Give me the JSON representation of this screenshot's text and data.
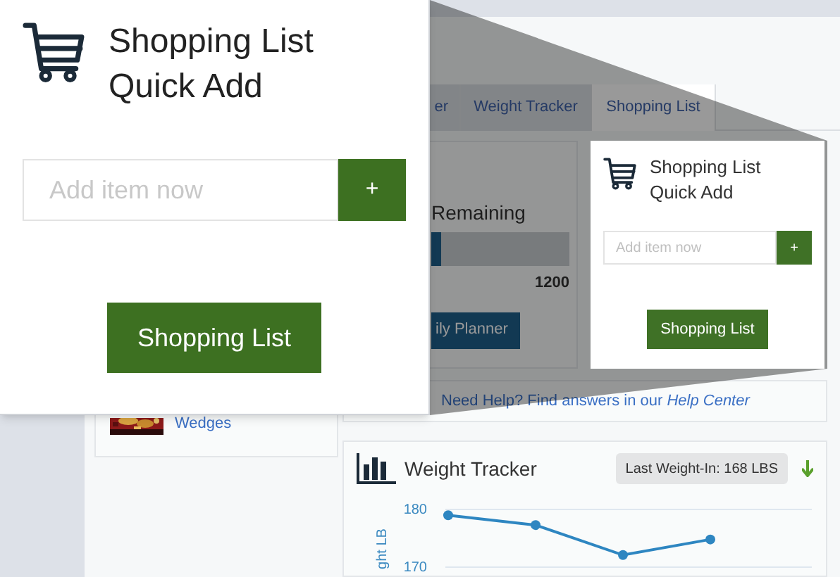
{
  "callout": {
    "title": "Shopping List Quick Add",
    "input": {
      "placeholder": "Add item now"
    },
    "add_button": "+",
    "list_button": "Shopping List"
  },
  "tabs": [
    {
      "label": "er",
      "selected": false
    },
    {
      "label": "Weight Tracker",
      "selected": false
    },
    {
      "label": "Shopping List",
      "selected": true
    }
  ],
  "calories_card": {
    "title": "Remaining",
    "level": 0.07,
    "reading": "1200",
    "button": "ily Planner"
  },
  "quick_add": {
    "title": "Shopping List Quick Add",
    "input": {
      "placeholder": "Add item now"
    },
    "add_button": "+",
    "list_button": "Shopping List"
  },
  "recipe": {
    "link": "Wedges"
  },
  "help": {
    "text": "Need Help? Find answers in our",
    "link": "Help Center"
  },
  "weight_tracker": {
    "title": "Weight Tracker",
    "badge": "Last Weight-In: 168 LBS",
    "falling": true,
    "chart_data": {
      "type": "line",
      "ylabel": "ght LB",
      "ylim": [
        170,
        180
      ],
      "yticks": [
        170,
        180
      ],
      "series": [
        {
          "color": "#2e86c1",
          "marker": "circle",
          "values": [
            179,
            177.3,
            172.1,
            174.8,
            null
          ]
        }
      ]
    }
  }
}
